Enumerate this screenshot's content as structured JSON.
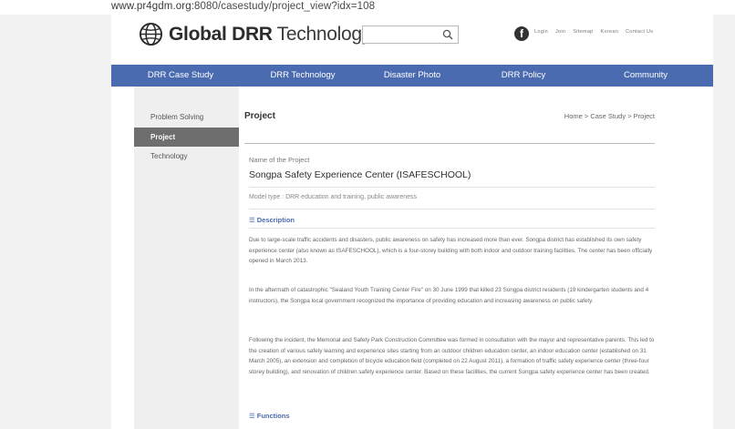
{
  "browser": {
    "url_host": "www.pr4gdm.org",
    "url_path": ":8080/casestudy/project_view?idx=108"
  },
  "header": {
    "logo_strong": "Global DRR",
    "logo_light": "Technology",
    "top_links": [
      "Login",
      "Join",
      "Sitemap",
      "Korean",
      "Contact Us"
    ]
  },
  "nav": {
    "items": [
      "DRR Case Study",
      "DRR Technology",
      "Disaster Photo",
      "DRR Policy",
      "Community"
    ]
  },
  "sidebar": {
    "items": [
      "Problem Solving",
      "Project",
      "Technology"
    ],
    "active_index": 1
  },
  "content": {
    "page_title": "Project",
    "breadcrumb": "Home > Case Study > Project",
    "name_label": "Name of the Project",
    "project_name": "Songpa Safety Experience Center (ISAFESCHOOL)",
    "model_type": "Model type : DRR education and training, public awareness",
    "description_heading": "Description",
    "paragraphs": [
      "Due to large-scale traffic accidents and disasters, public awareness on safety has increased more than ever. Songpa district has established its own safety experience center (also known as ISAFESCHOOL), which is a four-storey building with both indoor and outdoor training facilities. The center has been officially opened in March 2013.",
      "In the aftermath of catastrophic \"Sealand Youth Training Center Fire\" on 30 June 1999 that killed 23 Songpa district residents (19 kindergarten students and 4 instructors), the Songpa local government recognized the importance of providing education and increasing awareness on public safety.",
      "Following the incident, the Memorial and Safety Park Construction Committee was formed in consultation with the mayor and representative parents. This led to the creation of various safety learning and experience sites starting from an outdoor children education center, an indoor education center (established on 31 March 2005), an extension and completion of bicycle education field (completed on 22 August 2011), a formation of traffic safety experience center (three-four storey building), and renovation of children safety experience center. Based on these facilities, the current Songpa safety experience center has been created."
    ],
    "functions_heading": "Functions"
  },
  "colors": {
    "nav_bar": "#4a6bb0",
    "sidebar_active": "#6e6e6e",
    "sidebar_bg": "#efefef",
    "section_heading": "#4a6bb0"
  }
}
